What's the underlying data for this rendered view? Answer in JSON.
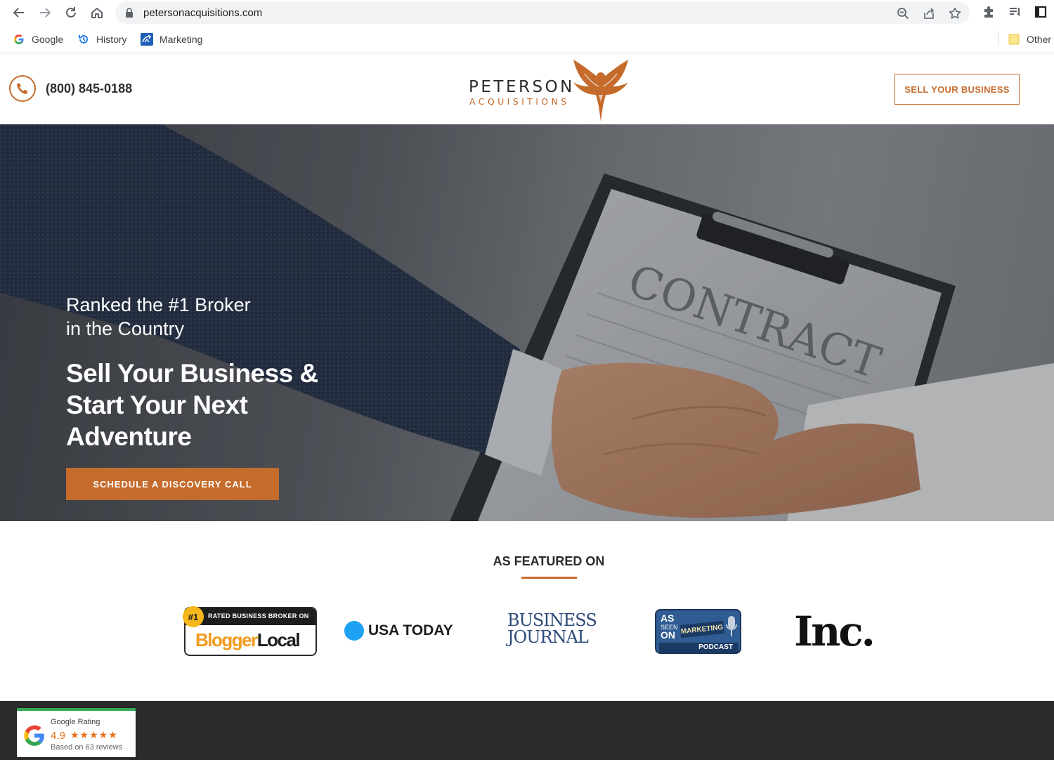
{
  "browser": {
    "url": "petersonacquisitions.com",
    "bookmarks": [
      {
        "label": "Google",
        "icon": "google-icon"
      },
      {
        "label": "History",
        "icon": "history-icon"
      },
      {
        "label": "Marketing",
        "icon": "marketing-icon"
      }
    ],
    "other_bookmarks": "Other"
  },
  "header": {
    "phone": "(800) 845-0188",
    "logo_word": "PETERSON",
    "logo_sub": "ACQUISITIONS",
    "sell_button": "SELL YOUR BUSINESS"
  },
  "hero": {
    "tagline_line1": "Ranked the #1 Broker",
    "tagline_line2": "in the Country",
    "title_line1": "Sell Your Business &",
    "title_line2": "Start Your Next",
    "title_line3": "Adventure",
    "cta": "SCHEDULE A DISCOVERY CALL",
    "photo_text": "CONTRACT"
  },
  "featured": {
    "title": "AS FEATURED ON",
    "outlets": {
      "bloggerlocal": {
        "badge": "#1",
        "rated": "RATED BUSINESS BROKER ON",
        "name_a": "Blogger",
        "name_b": "Local"
      },
      "usa_today": {
        "name": "USA TODAY"
      },
      "business_journal": {
        "line1": "BUSINESS",
        "line2": "JOURNAL"
      },
      "as_seen_on": {
        "as": "AS",
        "seen": "SEEN",
        "on": "ON",
        "show": "MARKETING",
        "podcast": "PODCAST"
      },
      "inc": {
        "name": "Inc."
      }
    }
  },
  "google_badge": {
    "title": "Google Rating",
    "score": "4.9",
    "stars": "★★★★★",
    "rating_value": 4.9,
    "based_on": "Based on 63 reviews"
  },
  "colors": {
    "accent": "#c56c2c",
    "footer": "#2b2b2b",
    "text_dark": "#2b2b2b"
  }
}
